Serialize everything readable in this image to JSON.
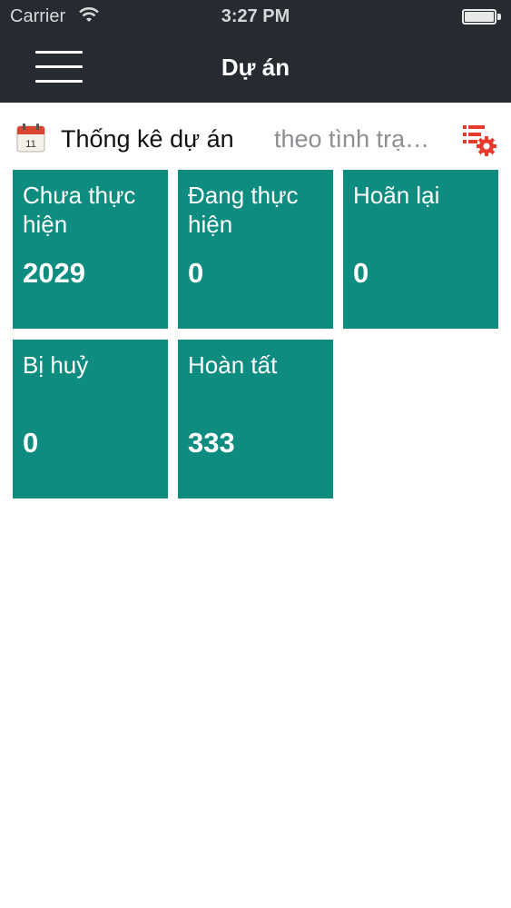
{
  "status_bar": {
    "carrier": "Carrier",
    "time": "3:27 PM",
    "wifi_icon": "wifi-icon",
    "battery_icon": "battery-icon"
  },
  "nav": {
    "title": "Dự án",
    "menu_icon": "hamburger-menu-icon",
    "background_color": "#262a31"
  },
  "filter": {
    "calendar_icon": "calendar-icon",
    "calendar_day": "11",
    "title": "Thống kê dự án",
    "selected": "theo tình trạ…",
    "settings_icon": "list-settings-icon",
    "settings_color": "#e8392d"
  },
  "tiles": [
    {
      "label": "Chưa thực hiện",
      "value": "2029"
    },
    {
      "label": "Đang thực hiện",
      "value": "0"
    },
    {
      "label": "Hoãn lại",
      "value": "0"
    },
    {
      "label": "Bị huỷ",
      "value": "0"
    },
    {
      "label": "Hoàn tất",
      "value": "333"
    }
  ],
  "tile_color": "#0e8c80"
}
